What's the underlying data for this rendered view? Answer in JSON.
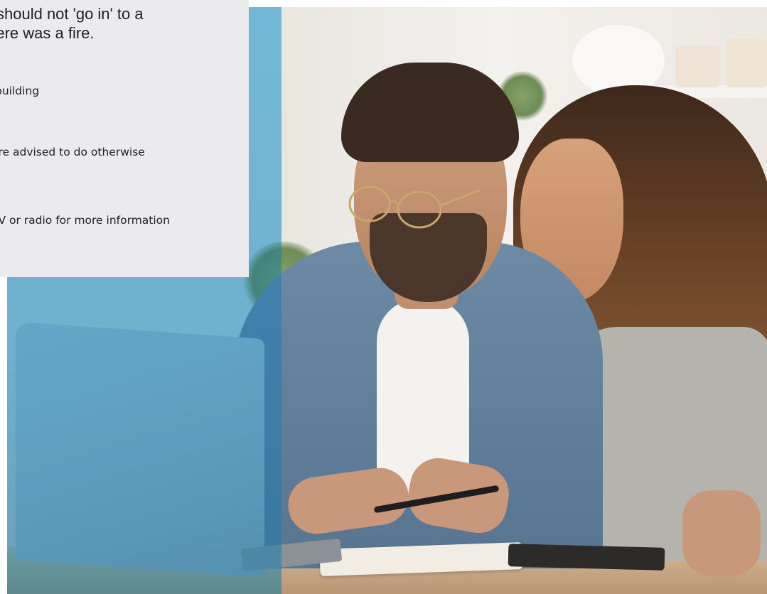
{
  "card": {
    "intro_line_1": "should not 'go in' to a",
    "intro_line_2": "there was a fire.",
    "items": [
      "building",
      "are advised to do otherwise",
      "TV or radio for more information"
    ]
  },
  "photo": {
    "subject": "couple-at-laptop-photo",
    "overlay_color": "#3aa3dc"
  }
}
